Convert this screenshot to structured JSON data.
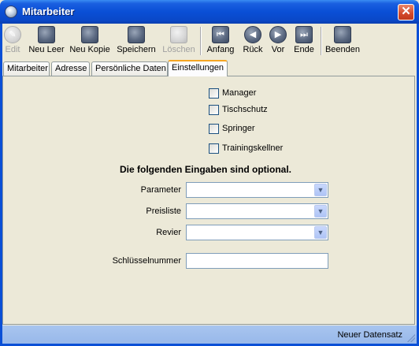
{
  "window": {
    "title": "Mitarbeiter",
    "close_glyph": "✕"
  },
  "toolbar": {
    "buttons": [
      {
        "label": "Edit",
        "icon": "pencil-icon",
        "enabled": false
      },
      {
        "label": "Neu Leer",
        "icon": "new-folder-icon",
        "enabled": true
      },
      {
        "label": "Neu Kopie",
        "icon": "copy-document-icon",
        "enabled": true
      },
      {
        "label": "Speichern",
        "icon": "save-icon",
        "enabled": true
      },
      {
        "label": "Löschen",
        "icon": "trash-icon",
        "enabled": false
      },
      {
        "label": "Anfang",
        "icon": "first-record-icon",
        "enabled": true
      },
      {
        "label": "Rück",
        "icon": "previous-record-icon",
        "enabled": true
      },
      {
        "label": "Vor",
        "icon": "next-record-icon",
        "enabled": true
      },
      {
        "label": "Ende",
        "icon": "last-record-icon",
        "enabled": true
      },
      {
        "label": "Beenden",
        "icon": "exit-icon",
        "enabled": true
      }
    ]
  },
  "tabs": [
    {
      "label": "Mitarbeiter",
      "active": false
    },
    {
      "label": "Adresse",
      "active": false
    },
    {
      "label": "Persönliche Daten",
      "active": false
    },
    {
      "label": "Einstellungen",
      "active": true
    }
  ],
  "settings": {
    "checkboxes": [
      {
        "label": "Manager",
        "checked": false
      },
      {
        "label": "Tischschutz",
        "checked": false
      },
      {
        "label": "Springer",
        "checked": false
      },
      {
        "label": "Trainingskellner",
        "checked": false
      }
    ],
    "optional_heading": "Die folgenden Eingaben sind optional.",
    "fields": {
      "parameter": {
        "label": "Parameter",
        "value": ""
      },
      "preisliste": {
        "label": "Preisliste",
        "value": ""
      },
      "revier": {
        "label": "Revier",
        "value": ""
      },
      "schluesselnummer": {
        "label": "Schlüsselnummer",
        "value": ""
      }
    }
  },
  "statusbar": {
    "text": "Neuer Datensatz"
  },
  "colors": {
    "titlebar": "#0a4fd6",
    "active_tab_accent": "#f5a623",
    "statusbar": "#a8c5ef"
  }
}
